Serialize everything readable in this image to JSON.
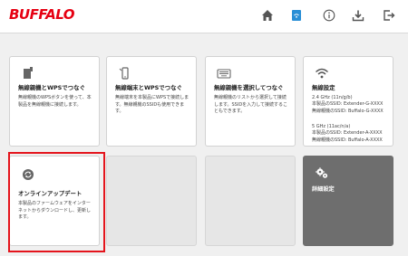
{
  "header": {
    "logo_text": "BUFFALO",
    "nav": [
      {
        "name": "home-icon"
      },
      {
        "name": "wifi-settings-icon"
      },
      {
        "name": "info-icon"
      },
      {
        "name": "download-icon"
      },
      {
        "name": "logout-icon"
      }
    ]
  },
  "tiles": {
    "wps_device": {
      "icon": "wps-device-icon",
      "title": "無線親機とWPSでつなぐ",
      "description": "無線親機のWPSボタンを使って、本製品を無線親機に接続します。"
    },
    "wps_client": {
      "icon": "smartphone-icon",
      "title": "無線端末とWPSでつなぐ",
      "description": "無線端末を本製品にWPSで接続します。無線親機のSSIDも使用できます。"
    },
    "select_ap": {
      "icon": "keyboard-icon",
      "title": "無線親機を選択してつなぐ",
      "description": "無線親機のリストから選択して接続します。SSIDを入力して接続することもできます。"
    },
    "wireless_settings": {
      "icon": "wifi-icon",
      "title": "無線設定",
      "band_24": {
        "label": "2.4 GHz (11n/g/b)",
        "ssid_line": "本製品のSSID: Extender-G-XXXX",
        "parent_line": "無線親機のSSID: Buffalo-G-XXXX"
      },
      "band_5": {
        "label": "5 GHz (11ac/n/a)",
        "ssid_line": "本製品のSSID: Extender-A-XXXX",
        "parent_line": "無線親機のSSID: Buffalo-A-XXXX"
      }
    },
    "online_update": {
      "icon": "refresh-icon",
      "title": "オンラインアップデート",
      "description": "本製品のファームウェアをインターネットからダウンロードし、更新します。"
    },
    "advanced_settings": {
      "icon": "gears-icon",
      "title": "詳細設定"
    }
  },
  "colors": {
    "brand_red": "#e60012",
    "highlight_red": "#e4141c",
    "nav_active_blue": "#2a8fd6",
    "dark_tile": "#6e6e6e",
    "background": "#f0f0f0"
  }
}
